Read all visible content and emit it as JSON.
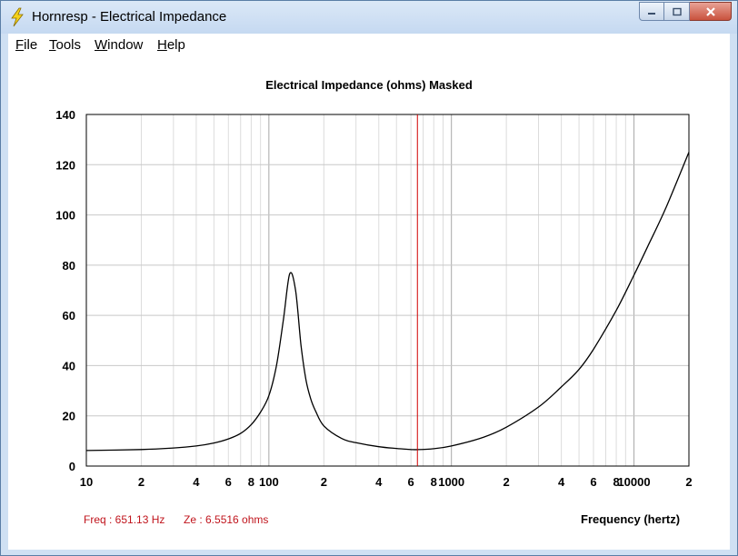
{
  "window": {
    "title": "Hornresp - Electrical Impedance",
    "icon": "lightning-icon"
  },
  "menu": [
    {
      "label": "File",
      "mnemonic": "F",
      "rest": "ile"
    },
    {
      "label": "Tools",
      "mnemonic": "T",
      "rest": "ools"
    },
    {
      "label": "Window",
      "mnemonic": "W",
      "rest": "indow"
    },
    {
      "label": "Help",
      "mnemonic": "H",
      "rest": "elp"
    }
  ],
  "status": {
    "freq": "Freq : 651.13 Hz",
    "ze": "Ze : 6.5516 ohms"
  },
  "colors": {
    "curve": "#000000",
    "cursor": "#d00000",
    "grid": "#c8c8c8",
    "status": "#c0141c"
  },
  "chart_data": {
    "type": "line",
    "title": "Electrical Impedance (ohms)   Masked",
    "xlabel": "Frequency (hertz)",
    "ylabel": "",
    "xscale": "log",
    "xlim": [
      10,
      20000
    ],
    "ylim": [
      0,
      140
    ],
    "yticks": [
      0,
      20,
      40,
      60,
      80,
      100,
      120,
      140
    ],
    "xticks": [
      {
        "value": 10,
        "label": "10"
      },
      {
        "value": 20,
        "label": "2"
      },
      {
        "value": 40,
        "label": "4"
      },
      {
        "value": 60,
        "label": "6"
      },
      {
        "value": 80,
        "label": "8"
      },
      {
        "value": 100,
        "label": "100"
      },
      {
        "value": 200,
        "label": "2"
      },
      {
        "value": 400,
        "label": "4"
      },
      {
        "value": 600,
        "label": "6"
      },
      {
        "value": 800,
        "label": "8"
      },
      {
        "value": 1000,
        "label": "1000"
      },
      {
        "value": 2000,
        "label": "2"
      },
      {
        "value": 4000,
        "label": "4"
      },
      {
        "value": 6000,
        "label": "6"
      },
      {
        "value": 8000,
        "label": "8"
      },
      {
        "value": 10000,
        "label": "10000"
      },
      {
        "value": 20000,
        "label": "2"
      }
    ],
    "grid": true,
    "cursor_x": 651.13,
    "series": [
      {
        "x": [
          10,
          20,
          30,
          40,
          50,
          60,
          70,
          80,
          90,
          100,
          110,
          120,
          130,
          140,
          150,
          160,
          170,
          180,
          200,
          250,
          300,
          400,
          500,
          600,
          651,
          800,
          1000,
          1500,
          2000,
          3000,
          4000,
          5000,
          6000,
          8000,
          10000,
          12000,
          15000,
          20000
        ],
        "y": [
          6.2,
          6.6,
          7.2,
          8.0,
          9.2,
          10.8,
          13.0,
          16.5,
          21.5,
          28.0,
          40.0,
          58.0,
          76.5,
          70.0,
          48.0,
          34.0,
          26.5,
          22.0,
          16.0,
          11.0,
          9.3,
          7.7,
          7.0,
          6.6,
          6.55,
          6.9,
          8.0,
          11.5,
          15.5,
          23.5,
          31.5,
          38.5,
          46.5,
          62.0,
          76.0,
          88.0,
          103.0,
          125.0
        ]
      }
    ]
  }
}
